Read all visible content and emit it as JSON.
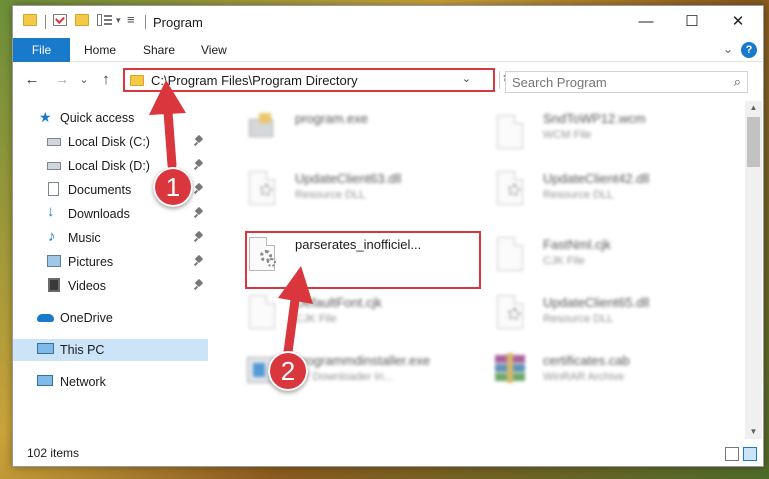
{
  "window": {
    "title": "Program",
    "controls": {
      "minimize": "—",
      "maximize": "☐",
      "close": "✕"
    }
  },
  "ribbon": {
    "tabs": [
      "File",
      "Home",
      "Share",
      "View"
    ],
    "help": "?",
    "expand": "⌄"
  },
  "navigation": {
    "back": "←",
    "forward": "→",
    "recent": "⌄",
    "up": "↑",
    "address_path": "C:\\Program Files\\Program Directory",
    "address_dropdown": "⌄",
    "refresh": "↻",
    "search_placeholder": "Search Program",
    "search_icon": "⌕"
  },
  "sidebar": {
    "items": [
      {
        "label": "Quick access",
        "icon": "star-icon",
        "pinned": false,
        "selected": false
      },
      {
        "label": "Local Disk (C:)",
        "icon": "drive-icon",
        "pinned": true,
        "selected": false
      },
      {
        "label": "Local Disk (D:)",
        "icon": "drive-icon",
        "pinned": true,
        "selected": false
      },
      {
        "label": "Documents",
        "icon": "documents-icon",
        "pinned": true,
        "selected": false
      },
      {
        "label": "Downloads",
        "icon": "download-icon",
        "pinned": true,
        "selected": false
      },
      {
        "label": "Music",
        "icon": "music-icon",
        "pinned": true,
        "selected": false
      },
      {
        "label": "Pictures",
        "icon": "pictures-icon",
        "pinned": true,
        "selected": false
      },
      {
        "label": "Videos",
        "icon": "videos-icon",
        "pinned": true,
        "selected": false
      },
      {
        "label": "OneDrive",
        "icon": "cloud-icon",
        "pinned": false,
        "selected": false
      },
      {
        "label": "This PC",
        "icon": "computer-icon",
        "pinned": false,
        "selected": true
      },
      {
        "label": "Network",
        "icon": "network-icon",
        "pinned": false,
        "selected": false
      }
    ]
  },
  "files": [
    {
      "name": "program.exe",
      "type": "",
      "icon": "exe-icon",
      "blurred": true
    },
    {
      "name": "SndToWP12.wcm",
      "type": "WCM File",
      "icon": "document-icon",
      "blurred": true
    },
    {
      "name": "UpdateClient63.dll",
      "type": "Resource DLL",
      "icon": "dll-icon",
      "blurred": true
    },
    {
      "name": "UpdateClient42.dll",
      "type": "Resource DLL",
      "icon": "dll-icon",
      "blurred": true
    },
    {
      "name": "parserates_inofficiel...",
      "type": "",
      "icon": "dll-gear-icon",
      "blurred": false
    },
    {
      "name": "FastNml.cjk",
      "type": "CJK File",
      "icon": "document-icon",
      "blurred": true
    },
    {
      "name": "DefaultFont.cjk",
      "type": "CJK File",
      "icon": "document-icon",
      "blurred": true
    },
    {
      "name": "UpdateClient65.dll",
      "type": "Resource DLL",
      "icon": "dll-icon",
      "blurred": true
    },
    {
      "name": "programmdinstaller.exe",
      "type": "SY Downloader In...",
      "icon": "installer-icon",
      "blurred": true
    },
    {
      "name": "certificates.cab",
      "type": "WinRAR Archive",
      "icon": "archive-icon",
      "blurred": true
    }
  ],
  "status": {
    "item_count": "102 items"
  },
  "annotations": {
    "badge_1": "1",
    "badge_2": "2",
    "color": "#d9363e"
  }
}
